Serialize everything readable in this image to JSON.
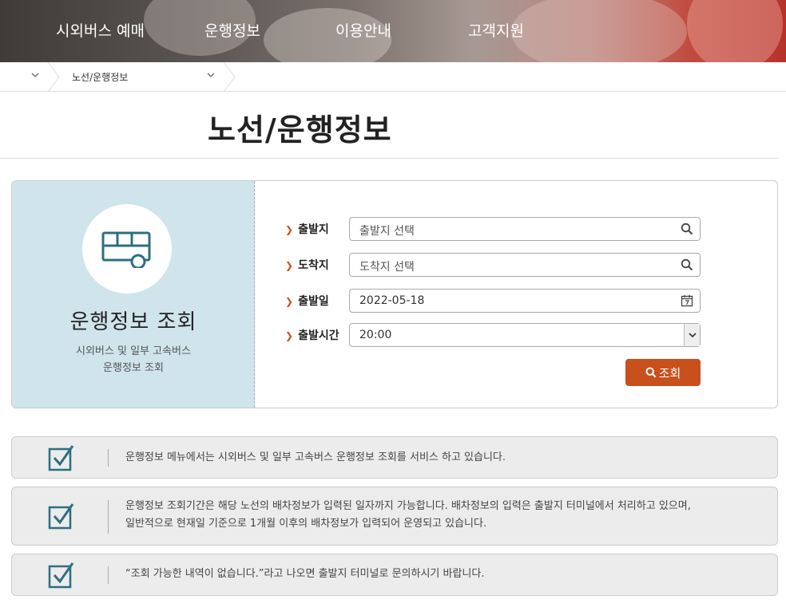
{
  "nav": {
    "items": [
      "시외버스 예매",
      "운행정보",
      "이용안내",
      "고객지원"
    ]
  },
  "breadcrumb": {
    "current": "노선/운행정보"
  },
  "page": {
    "title": "노선/운행정보"
  },
  "search_panel": {
    "title": "운행정보 조회",
    "desc_line1": "시외버스 및 일부 고속버스",
    "desc_line2": "운행정보 조회",
    "departure_label": "출발지",
    "departure_placeholder": "출발지 선택",
    "arrival_label": "도착지",
    "arrival_placeholder": "도착지 선택",
    "date_label": "출발일",
    "date_value": "2022-05-18",
    "time_label": "출발시간",
    "time_value": "20:00",
    "submit_label": "조회",
    "icons": {
      "bus": "bus-icon",
      "search": "search-icon",
      "calendar": "calendar-icon",
      "dropdown": "chevron-down-icon",
      "check": "checkbox-check-icon"
    },
    "accent_color": "#c8501c",
    "panel_bg_color": "#d0e4ec",
    "icon_color": "#2c6f80"
  },
  "notices": [
    {
      "line1": "운행정보 메뉴에서는 시외버스 및 일부 고속버스 운행정보 조회를 서비스 하고 있습니다.",
      "line2": ""
    },
    {
      "line1": "운행정보 조회기간은 해당 노선의 배차정보가 입력된 일자까지 가능합니다. 배차정보의 입력은 출발지 터미널에서 처리하고 있으며,",
      "line2": "일반적으로 현재일 기준으로 1개월 이후의 배차정보가 입력되어 운영되고 있습니다."
    },
    {
      "line1": "“조회 가능한 내역이 없습니다.”라고 나오면 출발지 터미널로 문의하시기 바랍니다.",
      "line2": ""
    }
  ]
}
